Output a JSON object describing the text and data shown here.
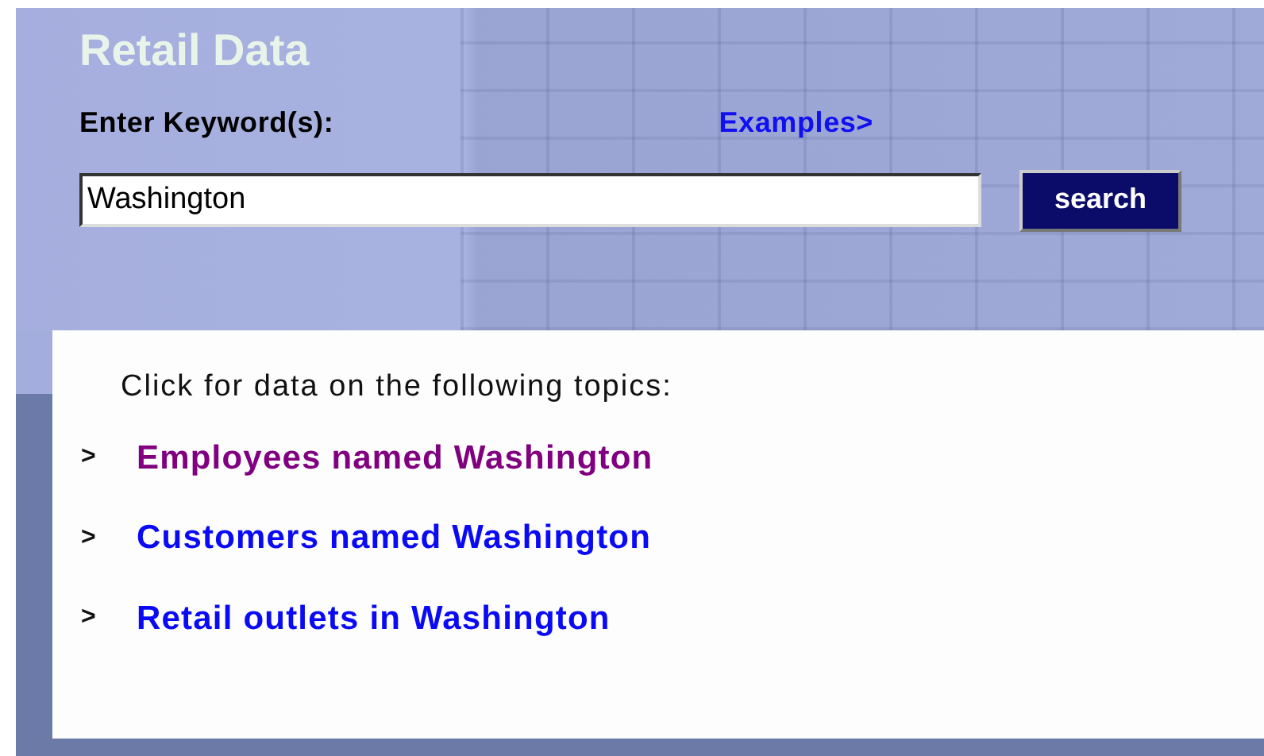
{
  "header": {
    "title": "Retail Data",
    "keyword_label": "Enter Keyword(s):",
    "examples_link": "Examples>",
    "search_field": {
      "value": "Washington"
    },
    "search_button": "search"
  },
  "topics": {
    "intro": "Click for data on the following topics:",
    "links": [
      {
        "bullet": ">",
        "label": "Employees named Washington",
        "visited": true
      },
      {
        "bullet": ">",
        "label": "Customers named Washington",
        "visited": false
      },
      {
        "bullet": ">",
        "label": "Retail outlets in Washington",
        "visited": false
      }
    ]
  }
}
